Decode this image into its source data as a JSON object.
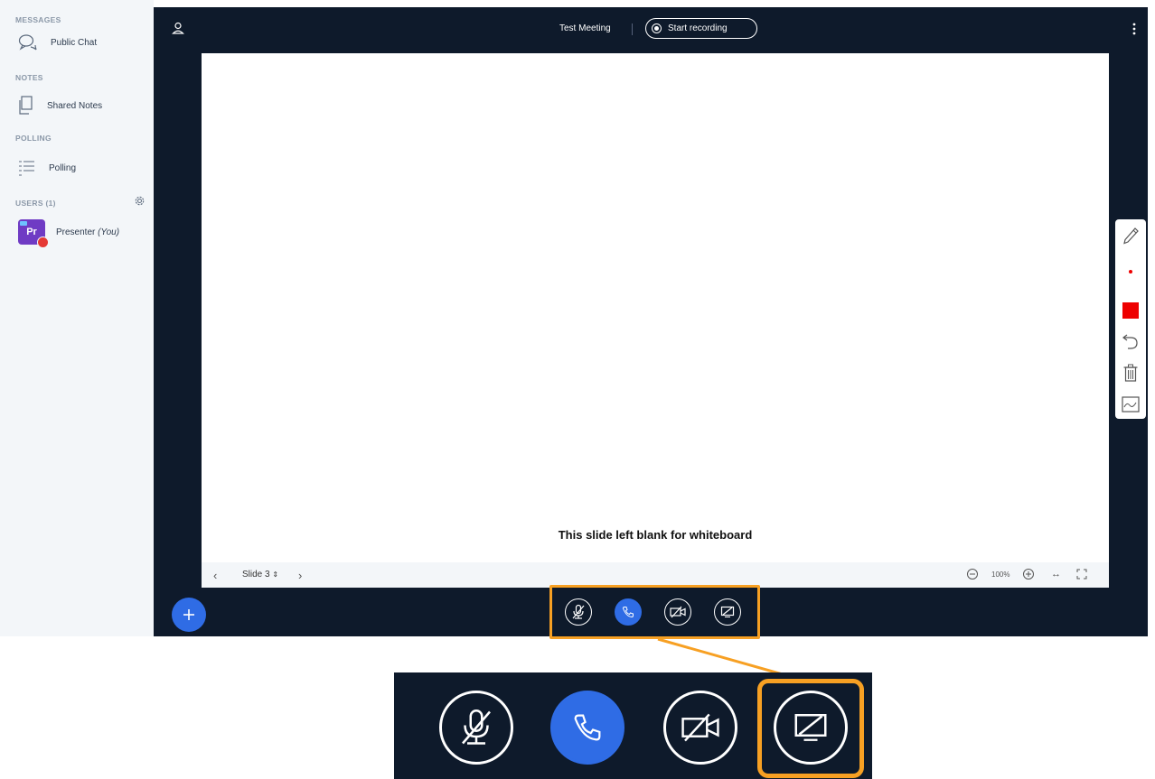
{
  "sidebar": {
    "messages_title": "MESSAGES",
    "public_chat": "Public Chat",
    "notes_title": "NOTES",
    "shared_notes": "Shared Notes",
    "polling_title": "POLLING",
    "polling": "Polling",
    "users_title": "USERS (1)",
    "user": {
      "initials": "Pr",
      "name": "Presenter",
      "suffix": "(You)",
      "avatar_color": "#6f3bc4"
    }
  },
  "header": {
    "meeting_title": "Test Meeting",
    "record_label": "Start recording"
  },
  "slide": {
    "text": "This slide left blank for whiteboard",
    "current": "Slide 3",
    "zoom": "100%"
  },
  "whiteboard_tools": [
    "pencil-icon",
    "thickness-dot-icon",
    "color-swatch-icon",
    "undo-icon",
    "trash-icon",
    "multi-user-whiteboard-icon"
  ],
  "controls": [
    "muted-microphone-icon",
    "phone-icon",
    "video-off-icon",
    "screen-share-icon"
  ],
  "colors": {
    "background": "#0e1a2b",
    "accent": "#2f6ce5",
    "highlight": "#f7a023",
    "pen_color": "#ee0000"
  }
}
